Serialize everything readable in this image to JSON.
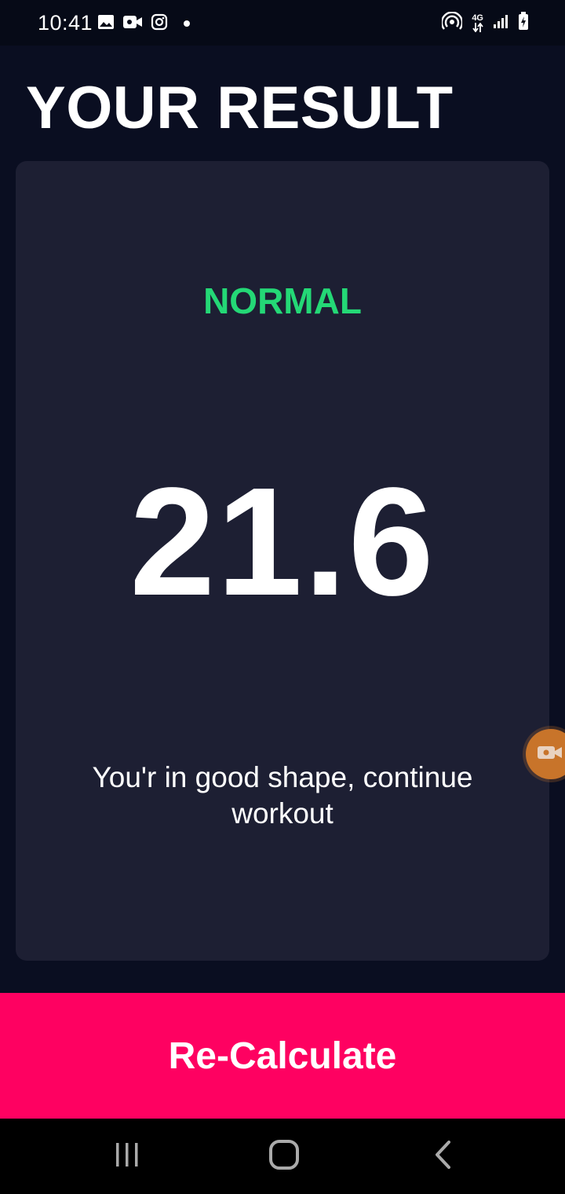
{
  "status_bar": {
    "time": "10:41",
    "network_type": "4G",
    "left_icons": [
      "gallery-icon",
      "video-call-icon",
      "instagram-icon",
      "notification-dot"
    ],
    "right_icons": [
      "hotspot-icon",
      "data-arrows-icon",
      "signal-icon",
      "battery-charging-icon"
    ]
  },
  "page": {
    "title": "YOUR RESULT"
  },
  "result": {
    "category": "NORMAL",
    "category_color": "#24d876",
    "value": "21.6",
    "advice": "You'r in good shape, continue workout"
  },
  "actions": {
    "recalculate_label": "Re-Calculate",
    "button_color": "#fe0161"
  },
  "navigation": {
    "items": [
      "recent-apps-icon",
      "home-icon",
      "back-icon"
    ]
  },
  "colors": {
    "background": "#0a0e21",
    "card": "#1d1f33"
  }
}
